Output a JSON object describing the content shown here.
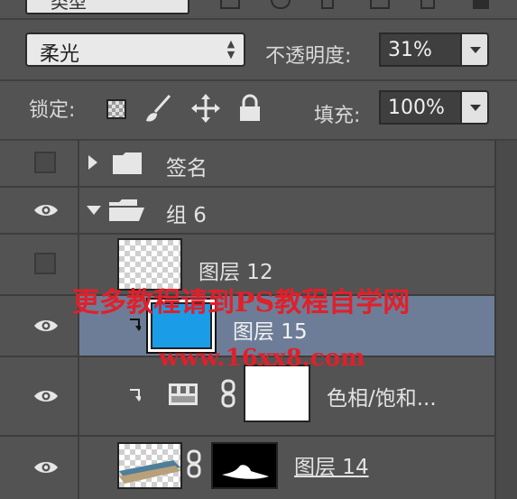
{
  "top_bar": {
    "kind_select": "类型"
  },
  "blend": {
    "mode": "柔光",
    "opacity_label": "不透明度:",
    "opacity_value": "31%"
  },
  "lock": {
    "label": "锁定:",
    "fill_label": "填充:",
    "fill_value": "100%"
  },
  "layers": [
    {
      "name": "签名",
      "type": "group",
      "expanded": false,
      "visible": false
    },
    {
      "name": "组 6",
      "type": "group",
      "expanded": true,
      "visible": true
    },
    {
      "name": "图层 12",
      "type": "layer",
      "visible": false
    },
    {
      "name": "图层 15",
      "type": "layer",
      "visible": true,
      "selected": true,
      "clipped": true,
      "thumb_color": "#1b9ce6"
    },
    {
      "name": "色相/饱和...",
      "type": "adjustment",
      "visible": true,
      "clipped": true
    },
    {
      "name": "图层 14",
      "type": "layer",
      "visible": true
    }
  ],
  "watermark": {
    "line1": "更多教程请到PS教程自学网",
    "line2": "www.16xx8.com"
  },
  "colors": {
    "panel": "#535353",
    "selected_row": "#6d7d97",
    "accent_blue": "#1b9ce6",
    "watermark_red": "#e0202a"
  }
}
